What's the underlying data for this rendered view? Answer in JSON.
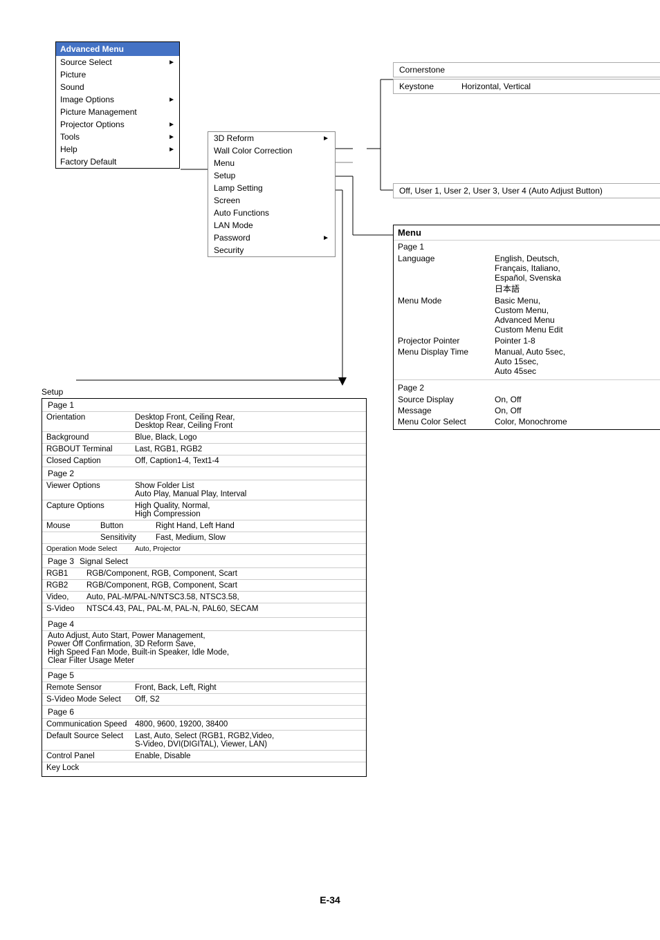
{
  "page": {
    "footer": "E-34"
  },
  "advanced_menu": {
    "title": "Advanced Menu",
    "items": [
      {
        "label": "Source Select",
        "has_arrow": true
      },
      {
        "label": "Picture",
        "has_arrow": false
      },
      {
        "label": "Sound",
        "has_arrow": false
      },
      {
        "label": "Image Options",
        "has_arrow": true
      },
      {
        "label": "Picture Management",
        "has_arrow": false
      },
      {
        "label": "Projector Options",
        "has_arrow": true
      },
      {
        "label": "Tools",
        "has_arrow": true
      },
      {
        "label": "Help",
        "has_arrow": true
      },
      {
        "label": "Factory Default",
        "has_arrow": false
      }
    ]
  },
  "projector_options_submenu": {
    "items": [
      {
        "label": "3D Reform",
        "has_arrow": true
      },
      {
        "label": "Wall Color Correction",
        "has_arrow": false
      },
      {
        "label": "Menu",
        "has_arrow": false
      },
      {
        "label": "Setup",
        "has_arrow": false
      },
      {
        "label": "Lamp Setting",
        "has_arrow": false
      },
      {
        "label": "Screen",
        "has_arrow": false
      },
      {
        "label": "Auto Functions",
        "has_arrow": false
      },
      {
        "label": "LAN Mode",
        "has_arrow": false
      },
      {
        "label": "Password",
        "has_arrow": true
      },
      {
        "label": "Security",
        "has_arrow": false
      }
    ]
  },
  "cornerstone": {
    "label": "Cornerstone"
  },
  "keystone": {
    "label": "Keystone",
    "value": "Horizontal, Vertical"
  },
  "user_options": {
    "value": "Off, User 1, User 2, User 3, User 4 (Auto  Adjust Button)"
  },
  "menu_box": {
    "title": "Menu",
    "page1": {
      "label": "Page 1",
      "rows": [
        {
          "label": "Language",
          "value": "English, Deutsch,\nFrançais, Italiano,\nEspañol, Svenska\n日本語"
        },
        {
          "label": "Menu Mode",
          "value": "Basic Menu,\nCustom Menu,\nAdvanced Menu\nCustom Menu Edit"
        },
        {
          "label": "Projector Pointer",
          "value": "Pointer 1-8"
        },
        {
          "label": "Menu Display Time",
          "value": "Manual, Auto 5sec,\nAuto 15sec,\nAuto 45sec"
        }
      ]
    },
    "page2": {
      "label": "Page 2",
      "rows": [
        {
          "label": "Source Display",
          "value": "On, Off"
        },
        {
          "label": "Message",
          "value": "On, Off"
        },
        {
          "label": "Menu Color Select",
          "value": "Color, Monochrome"
        }
      ]
    }
  },
  "setup": {
    "title": "Setup",
    "page1": {
      "label": "Page 1",
      "rows": [
        {
          "label": "Orientation",
          "sub": "",
          "value": "Desktop Front, Ceiling Rear,\nDesktop Rear, Ceiling Front"
        },
        {
          "label": "Background",
          "sub": "",
          "value": "Blue, Black, Logo"
        },
        {
          "label": "RGBOUT Terminal",
          "sub": "",
          "value": "Last, RGB1, RGB2"
        },
        {
          "label": "Closed Caption",
          "sub": "",
          "value": "Off, Caption1-4, Text1-4"
        }
      ]
    },
    "page2": {
      "label": "Page 2",
      "rows": [
        {
          "label": "Viewer Options",
          "sub": "",
          "value": "Show Folder List\nAuto Play, Manual Play, Interval"
        },
        {
          "label": "Capture Options",
          "sub": "",
          "value": "High Quality, Normal,\nHigh Compression"
        },
        {
          "label": "Mouse",
          "sub": "Button",
          "value": "Right Hand, Left Hand"
        },
        {
          "label": "",
          "sub": "Sensitivity",
          "value": "Fast, Medium, Slow"
        },
        {
          "label": "Operation Mode Select",
          "sub": "",
          "value": "Auto, Projector",
          "small": true
        }
      ]
    },
    "page3": {
      "label": "Page 3",
      "sublabel": "Signal Select",
      "rows": [
        {
          "label": "RGB1",
          "value": "RGB/Component, RGB, Component, Scart"
        },
        {
          "label": "RGB2",
          "value": "RGB/Component, RGB, Component, Scart"
        },
        {
          "label": "Video,",
          "value": "Auto, PAL-M/PAL-N/NTSC3.58, NTSC3.58,"
        },
        {
          "label": "S-Video",
          "value": "NTSC4.43, PAL, PAL-M, PAL-N, PAL60, SECAM"
        }
      ]
    },
    "page4": {
      "label": "Page 4",
      "lines": [
        "Auto Adjust, Auto Start, Power Management,",
        "Power Off Confirmation, 3D Reform Save,",
        "High Speed Fan Mode, Built-in Speaker, Idle Mode,",
        "Clear Filter Usage Meter"
      ]
    },
    "page5": {
      "label": "Page 5",
      "rows": [
        {
          "label": "Remote Sensor",
          "value": "Front, Back, Left, Right"
        },
        {
          "label": "S-Video Mode Select",
          "value": "Off, S2"
        }
      ]
    },
    "page6": {
      "label": "Page 6",
      "rows": [
        {
          "label": "Communication Speed",
          "value": "4800, 9600, 19200, 38400"
        },
        {
          "label": "Default Source Select",
          "value": "Last, Auto, Select (RGB1, RGB2,Video,\nS-Video, DVI(DIGITAL), Viewer, LAN)"
        },
        {
          "label": "Control Panel",
          "value": "Enable, Disable"
        },
        {
          "label": "Key Lock",
          "value": ""
        }
      ]
    }
  }
}
